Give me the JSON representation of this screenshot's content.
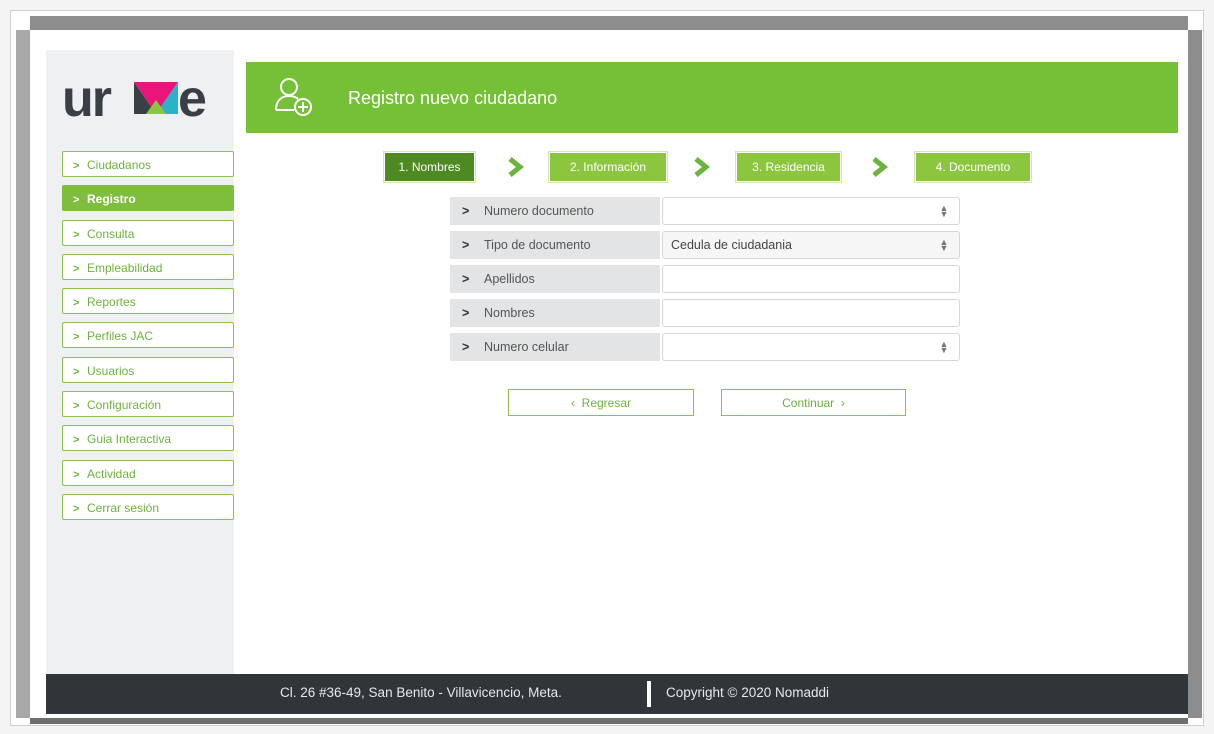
{
  "brand": {
    "logo_text": "urve",
    "colors": {
      "green": "#76c038",
      "dark_green": "#4d8a22",
      "footer": "#2f3539"
    }
  },
  "header": {
    "title": "Registro nuevo ciudadano",
    "icon": "add-user-icon"
  },
  "sidebar": {
    "items": [
      {
        "label": "Ciudadanos",
        "active": false
      },
      {
        "label": "Registro",
        "active": true
      },
      {
        "label": "Consulta",
        "active": false
      },
      {
        "label": "Empleabilidad",
        "active": false
      },
      {
        "label": "Reportes",
        "active": false
      },
      {
        "label": "Perfiles JAC",
        "active": false
      },
      {
        "label": "Usuarios",
        "active": false
      },
      {
        "label": "Configuración",
        "active": false
      },
      {
        "label": "Guia Interactiva",
        "active": false
      },
      {
        "label": "Actividad",
        "active": false
      },
      {
        "label": "Cerrar sesión",
        "active": false
      }
    ]
  },
  "steps": [
    {
      "label": "1. Nombres",
      "state": "current"
    },
    {
      "label": "2. Información",
      "state": "todo"
    },
    {
      "label": "3. Residencia",
      "state": "todo"
    },
    {
      "label": "4. Documento",
      "state": "todo"
    }
  ],
  "form": {
    "fields": [
      {
        "label": "Numero documento",
        "value": "",
        "type": "number"
      },
      {
        "label": "Tipo de documento",
        "value": "Cedula de ciudadania",
        "type": "select"
      },
      {
        "label": "Apellidos",
        "value": "",
        "type": "text"
      },
      {
        "label": "Nombres",
        "value": "",
        "type": "text"
      },
      {
        "label": "Numero celular",
        "value": "",
        "type": "number"
      }
    ],
    "back_label": "Regresar",
    "continue_label": "Continuar"
  },
  "footer": {
    "address": "Cl. 26 #36-49, San Benito - Villavicencio, Meta.",
    "copyright": "Copyright © 2020 Nomaddi"
  }
}
